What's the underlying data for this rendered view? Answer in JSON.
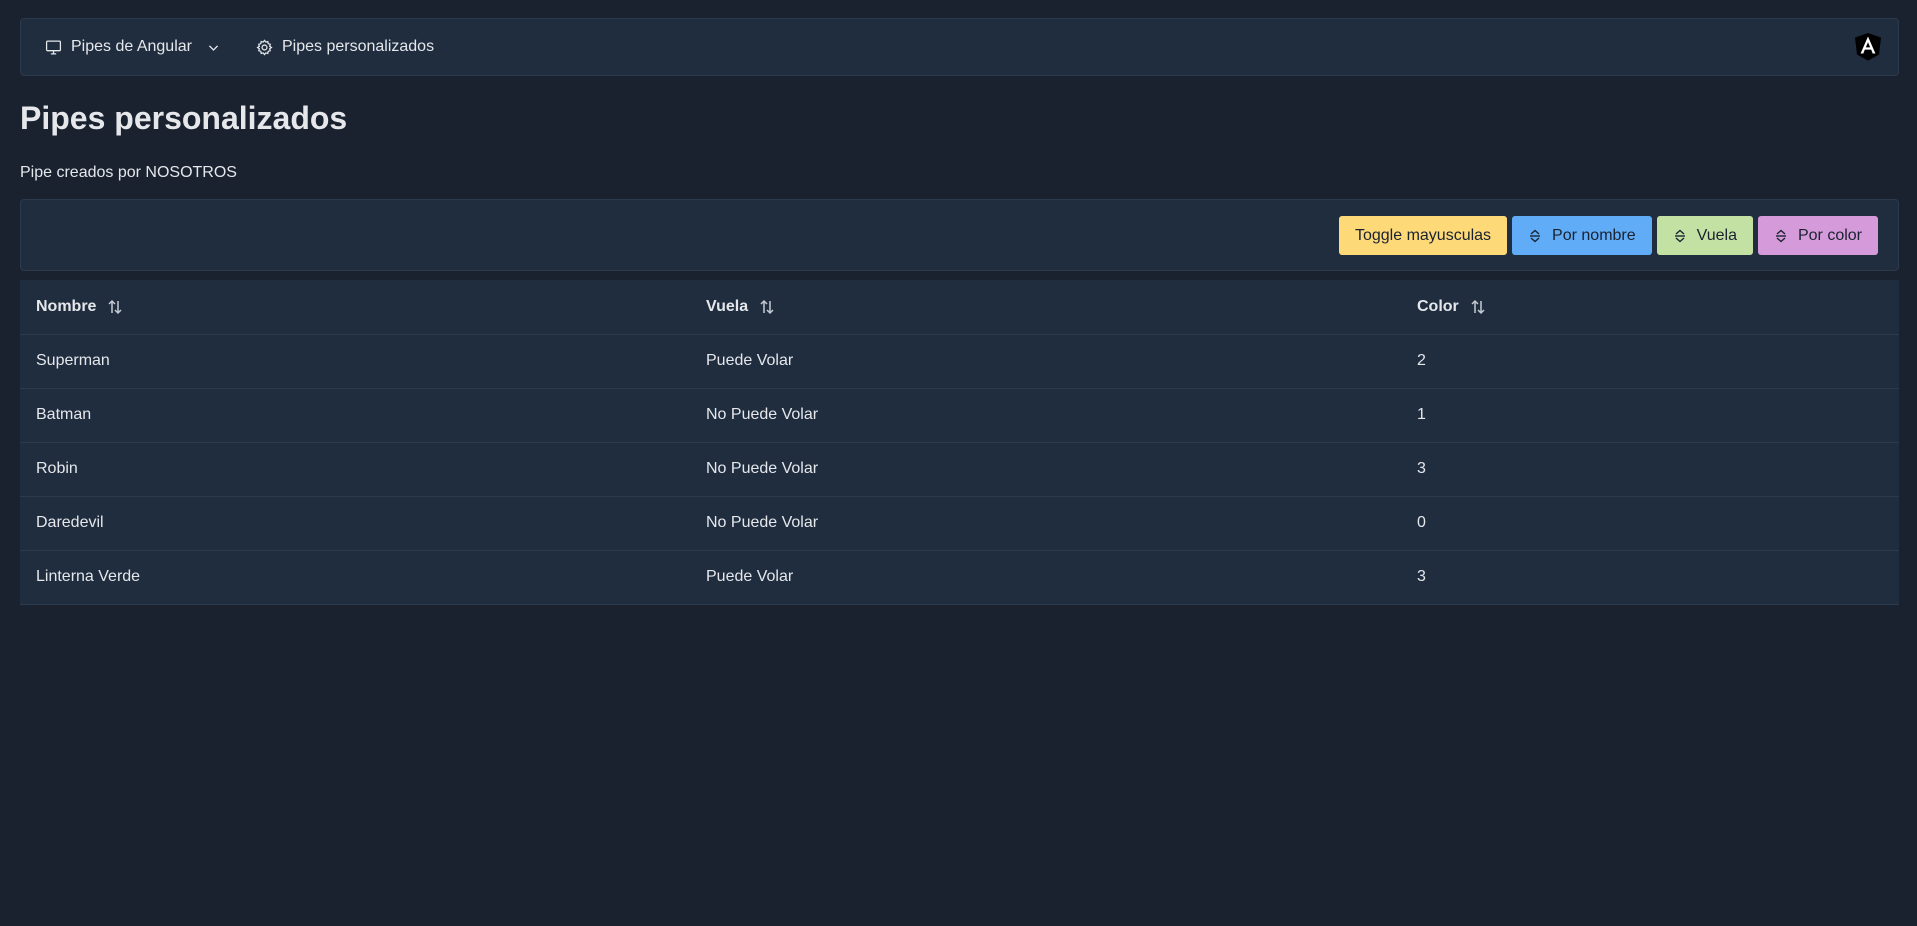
{
  "menubar": {
    "items": [
      {
        "label": "Pipes de Angular",
        "icon": "desktop-icon",
        "has_dropdown": true
      },
      {
        "label": "Pipes personalizados",
        "icon": "gear-icon",
        "has_dropdown": false
      }
    ],
    "logo": "angular-logo-icon"
  },
  "page": {
    "title": "Pipes personalizados",
    "subtitle": "Pipe creados por NOSOTROS"
  },
  "toolbar": {
    "buttons": [
      {
        "label": "Toggle mayusculas",
        "color": "#fdd978",
        "icon": null
      },
      {
        "label": "Por nombre",
        "color": "#60acf7",
        "icon": "sort-icon"
      },
      {
        "label": "Vuela",
        "color": "#c4e1a4",
        "icon": "sort-icon"
      },
      {
        "label": "Por color",
        "color": "#d59ad9",
        "icon": "sort-icon"
      }
    ]
  },
  "table": {
    "columns": [
      "Nombre",
      "Vuela",
      "Color"
    ],
    "rows": [
      [
        "Superman",
        "Puede Volar",
        "2"
      ],
      [
        "Batman",
        "No Puede Volar",
        "1"
      ],
      [
        "Robin",
        "No Puede Volar",
        "3"
      ],
      [
        "Daredevil",
        "No Puede Volar",
        "0"
      ],
      [
        "Linterna Verde",
        "Puede Volar",
        "3"
      ]
    ]
  },
  "colors": {
    "background": "#1a2230",
    "surface": "#1f2d3f",
    "border": "#2c3a4d",
    "text": "#e5e7eb"
  }
}
